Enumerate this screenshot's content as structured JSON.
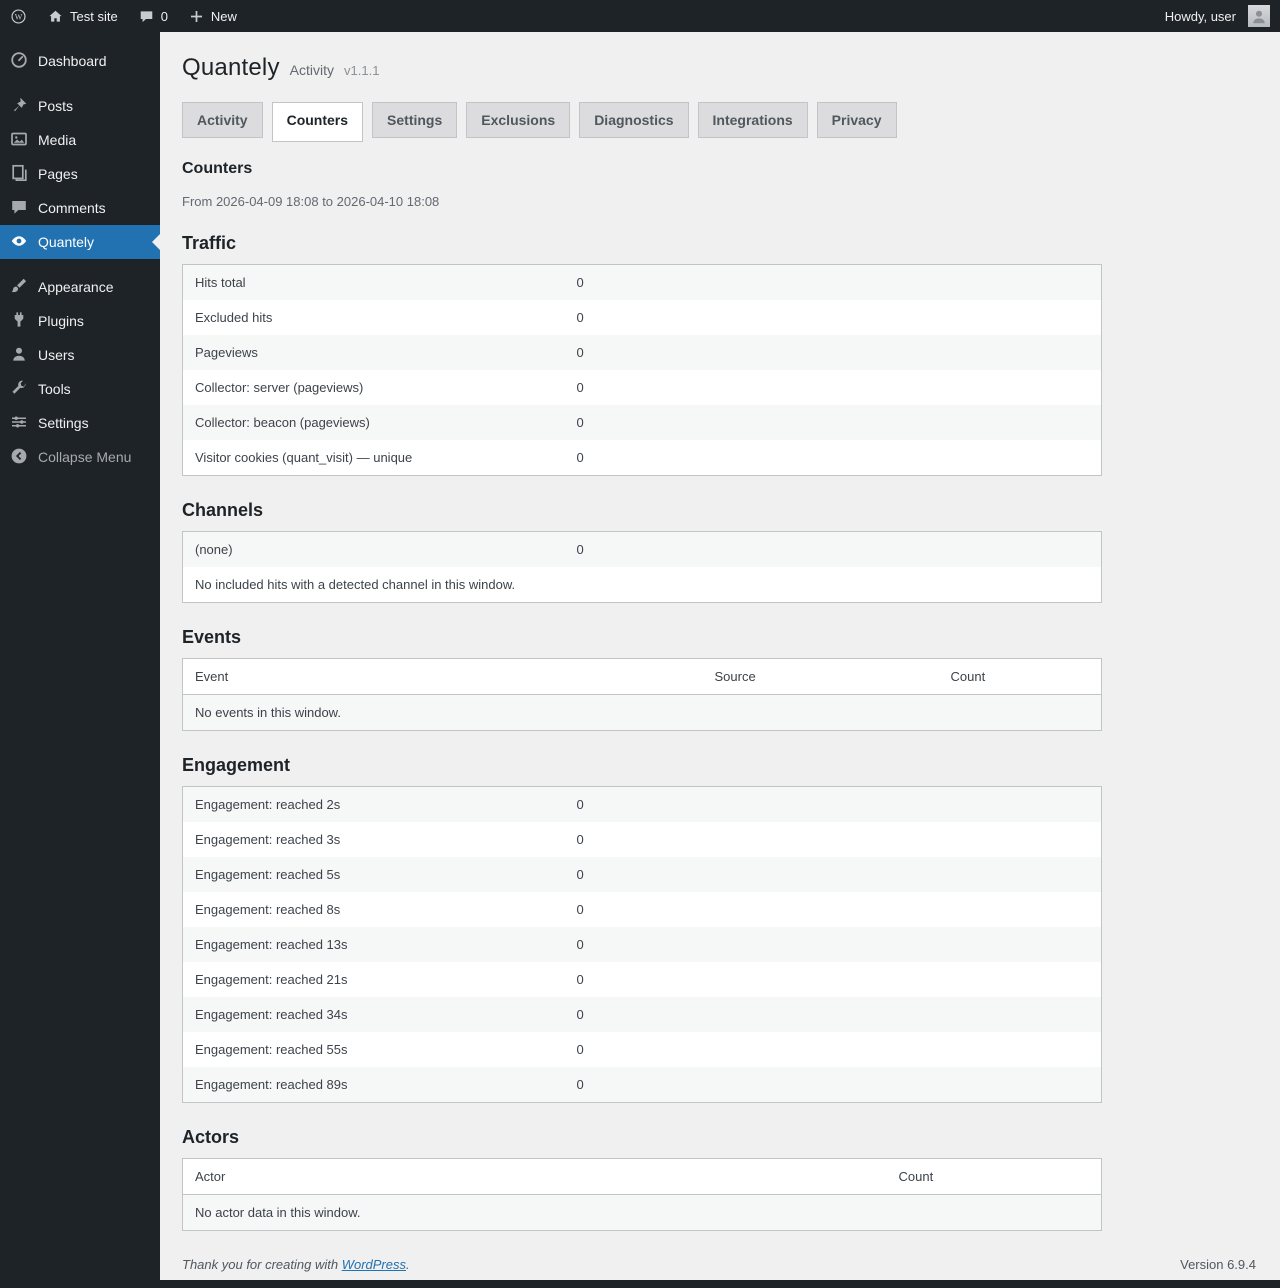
{
  "admin_bar": {
    "site_name": "Test site",
    "comment_count": "0",
    "new_label": "New",
    "howdy_text": "Howdy, user"
  },
  "sidebar": {
    "items": [
      {
        "label": "Dashboard"
      },
      {
        "label": "Posts"
      },
      {
        "label": "Media"
      },
      {
        "label": "Pages"
      },
      {
        "label": "Comments"
      },
      {
        "label": "Quantely"
      },
      {
        "label": "Appearance"
      },
      {
        "label": "Plugins"
      },
      {
        "label": "Users"
      },
      {
        "label": "Tools"
      },
      {
        "label": "Settings"
      }
    ],
    "collapse_label": "Collapse Menu"
  },
  "header": {
    "title": "Quantely",
    "subtitle": "Activity",
    "version": "v1.1.1"
  },
  "tabs": {
    "activity": "Activity",
    "counters": "Counters",
    "settings": "Settings",
    "exclusions": "Exclusions",
    "diagnostics": "Diagnostics",
    "integrations": "Integrations",
    "privacy": "Privacy"
  },
  "counters_page": {
    "heading": "Counters",
    "date_range": "From 2026-04-09 18:08 to 2026-04-10 18:08"
  },
  "traffic": {
    "title": "Traffic",
    "rows": [
      {
        "label": "Hits total",
        "value": "0"
      },
      {
        "label": "Excluded hits",
        "value": "0"
      },
      {
        "label": "Pageviews",
        "value": "0"
      },
      {
        "label": "Collector: server (pageviews)",
        "value": "0"
      },
      {
        "label": "Collector: beacon (pageviews)",
        "value": "0"
      },
      {
        "label": "Visitor cookies (quant_visit) — unique",
        "value": "0"
      }
    ]
  },
  "channels": {
    "title": "Channels",
    "rows": [
      {
        "label": "(none)",
        "value": "0"
      }
    ],
    "empty_message": "No included hits with a detected channel in this window."
  },
  "events": {
    "title": "Events",
    "columns": {
      "event": "Event",
      "source": "Source",
      "count": "Count"
    },
    "empty_message": "No events in this window."
  },
  "engagement": {
    "title": "Engagement",
    "rows": [
      {
        "label": "Engagement: reached 2s",
        "value": "0"
      },
      {
        "label": "Engagement: reached 3s",
        "value": "0"
      },
      {
        "label": "Engagement: reached 5s",
        "value": "0"
      },
      {
        "label": "Engagement: reached 8s",
        "value": "0"
      },
      {
        "label": "Engagement: reached 13s",
        "value": "0"
      },
      {
        "label": "Engagement: reached 21s",
        "value": "0"
      },
      {
        "label": "Engagement: reached 34s",
        "value": "0"
      },
      {
        "label": "Engagement: reached 55s",
        "value": "0"
      },
      {
        "label": "Engagement: reached 89s",
        "value": "0"
      }
    ]
  },
  "actors": {
    "title": "Actors",
    "columns": {
      "actor": "Actor",
      "count": "Count"
    },
    "empty_message": "No actor data in this window."
  },
  "footer": {
    "thanks_prefix": "Thank you for creating with ",
    "link_label": "WordPress",
    "suffix": ".",
    "version": "Version 6.9.4"
  },
  "colors": {
    "accent": "#2271b1",
    "admin_bar_bg": "#1d2327",
    "content_bg": "#f0f0f1"
  }
}
